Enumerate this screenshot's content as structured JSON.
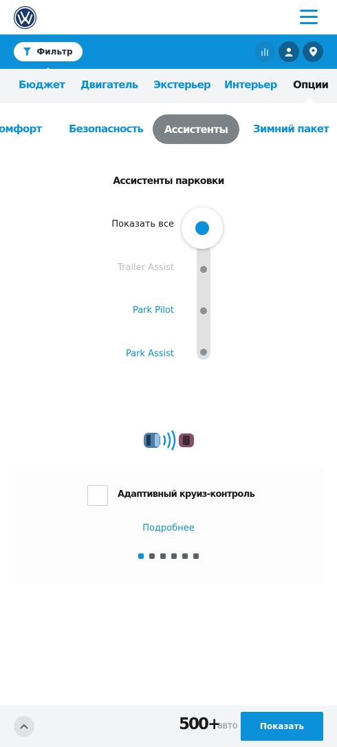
{
  "header": {
    "logo": "vw-logo",
    "menu_icon": "hamburger-menu-icon"
  },
  "filterbar": {
    "filter_label": "Фильтр",
    "icons": [
      "bar-chart-icon",
      "user-icon",
      "map-pin-icon"
    ]
  },
  "category_tabs": [
    {
      "label": "Бюджет"
    },
    {
      "label": "Двигатель"
    },
    {
      "label": "Экстерьер"
    },
    {
      "label": "Интерьер"
    },
    {
      "label": "Опции",
      "active": true
    }
  ],
  "sub_tabs": [
    {
      "label": "омфорт"
    },
    {
      "label": "Безопасность"
    },
    {
      "label": "Ассистенты",
      "active": true
    },
    {
      "label": "Зимний пакет"
    }
  ],
  "parking": {
    "title": "Ассистенты парковки",
    "options": [
      {
        "label": "Показать все",
        "state": "selected"
      },
      {
        "label": "Trailer Assist",
        "state": "disabled"
      },
      {
        "label": "Park Pilot",
        "state": "normal"
      },
      {
        "label": "Park Assist",
        "state": "normal"
      }
    ]
  },
  "cruise": {
    "icon": "adaptive-cruise-control-icon",
    "label": "Адаптивный круиз-контроль",
    "checked": false,
    "more_link": "Подробнее",
    "pagination": {
      "total": 6,
      "active": 1
    }
  },
  "bottombar": {
    "count": "500+",
    "count_unit": "авто",
    "show_button": "Показать"
  },
  "colors": {
    "brand_blue": "#0c91d8",
    "active_pill": "#7d8287",
    "panel_grey": "#f2f4f5"
  }
}
